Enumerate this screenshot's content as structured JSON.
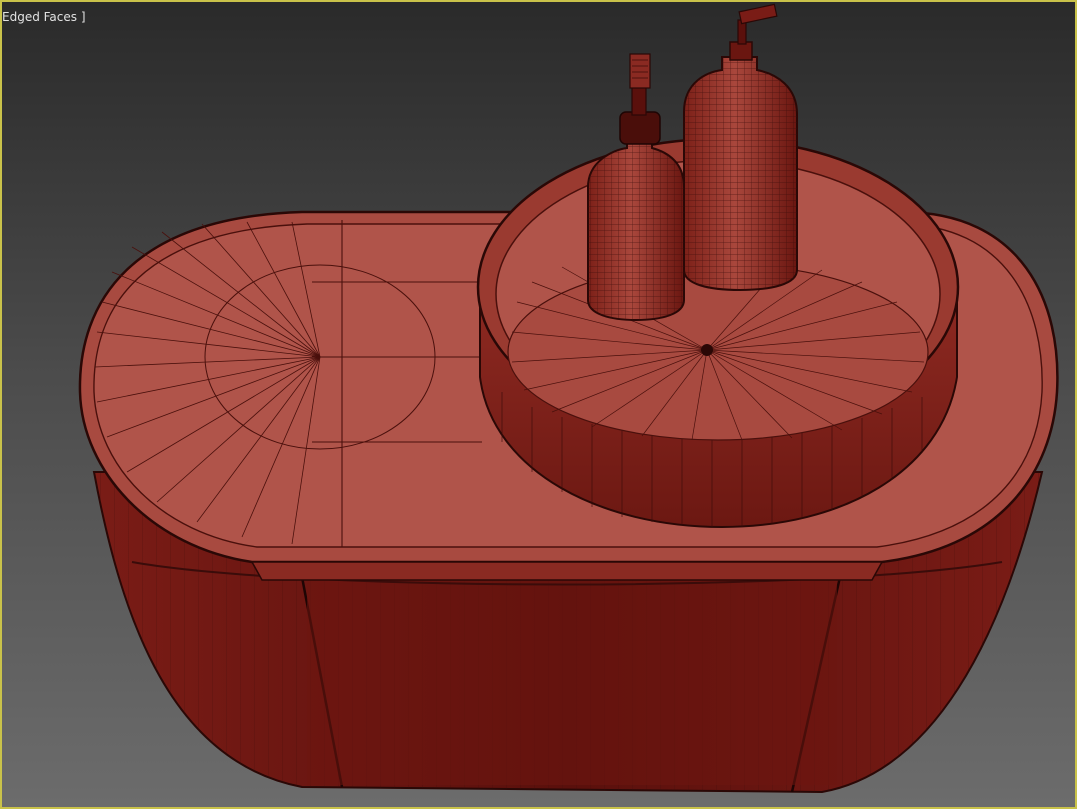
{
  "viewport": {
    "label": "Edged Faces ]",
    "border_color": "#c9c24a",
    "model_color": "#a84a40",
    "wire_color": "#3a0c0a"
  },
  "scene": {
    "objects": [
      "cabinet-body",
      "cabinet-countertop",
      "round-tray",
      "large-bottle",
      "small-bottle"
    ]
  }
}
